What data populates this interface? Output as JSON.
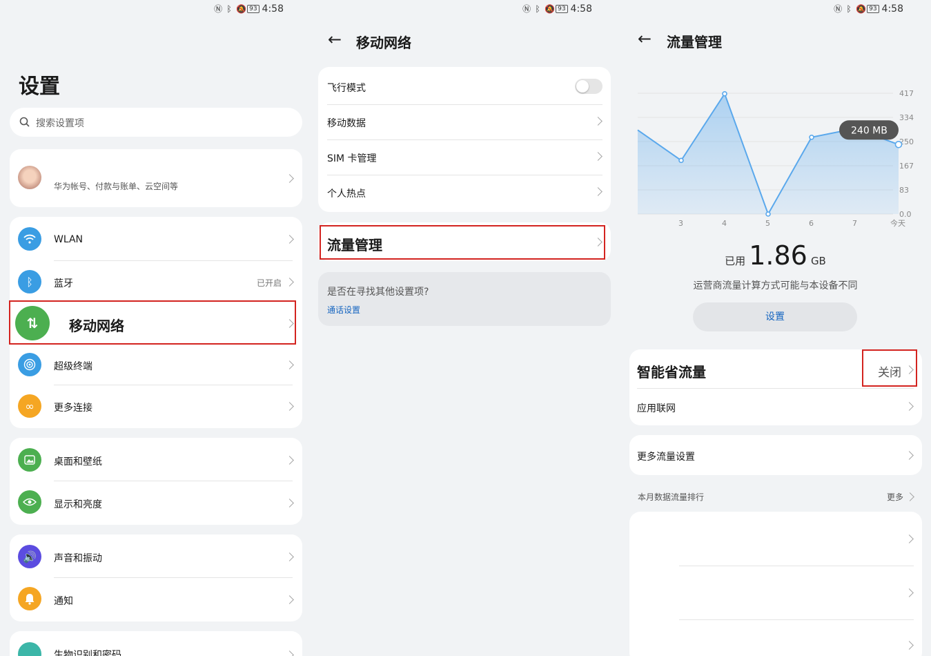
{
  "status": {
    "time": "4:58",
    "battery": "93"
  },
  "p1": {
    "title": "设置",
    "search": {
      "placeholder": "搜索设置项"
    },
    "account": {
      "subtitle": "华为帐号、付款与账单、云空间等"
    },
    "items": {
      "wlan": "WLAN",
      "bluetooth": "蓝牙",
      "bluetooth_status": "已开启",
      "mobile": "移动网络",
      "super": "超级终端",
      "more_conn": "更多连接",
      "desktop": "桌面和壁纸",
      "display": "显示和亮度",
      "sound": "声音和振动",
      "notify": "通知",
      "bio": "生物识别和密码"
    }
  },
  "p2": {
    "title": "移动网络",
    "items": {
      "airplane": "飞行模式",
      "mobile_data": "移动数据",
      "sim": "SIM 卡管理",
      "hotspot": "个人热点",
      "traffic": "流量管理"
    },
    "hint": {
      "question": "是否在寻找其他设置项?",
      "link": "通话设置"
    }
  },
  "p3": {
    "title": "流量管理",
    "tooltip": "240 MB",
    "used_prefix": "已用",
    "used_value": "1.86",
    "used_unit": "GB",
    "note": "运营商流量计算方式可能与本设备不同",
    "settings_button": "设置",
    "smart_saver": "智能省流量",
    "smart_saver_status": "关闭",
    "app_network": "应用联网",
    "more_settings": "更多流量设置",
    "ranking": "本月数据流量排行",
    "more": "更多"
  },
  "chart_data": {
    "type": "area",
    "x": [
      "2",
      "3",
      "4",
      "5",
      "6",
      "7",
      "今天"
    ],
    "x_tick_labels": [
      "3",
      "4",
      "5",
      "6",
      "7",
      "今天"
    ],
    "values": [
      290,
      185,
      415,
      0,
      265,
      295,
      240
    ],
    "y_tick_labels": [
      "417",
      "334",
      "250",
      "167",
      "83",
      "0.0"
    ],
    "ylim": [
      0,
      417
    ],
    "color": "#5aa8ec"
  }
}
